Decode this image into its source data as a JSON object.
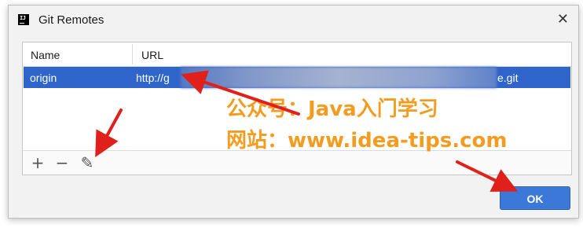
{
  "window": {
    "title": "Git Remotes",
    "close_glyph": "✕"
  },
  "table": {
    "columns": [
      "Name",
      "URL"
    ],
    "rows": [
      {
        "name": "origin",
        "url_visible_start": "http://g",
        "url_visible_end": "e.git",
        "selected": true
      }
    ]
  },
  "toolbar": {
    "add_glyph": "+",
    "remove_glyph": "−",
    "edit_glyph": "✎"
  },
  "buttons": {
    "ok_label": "OK"
  },
  "watermark": {
    "line1": "公众号：Java入门学习",
    "line2": "网站：www.idea-tips.com"
  },
  "colors": {
    "selection": "#2f65ca",
    "ok_button": "#3b78d8",
    "watermark": "#f39c1f",
    "annotation_arrow": "#e0201b"
  }
}
